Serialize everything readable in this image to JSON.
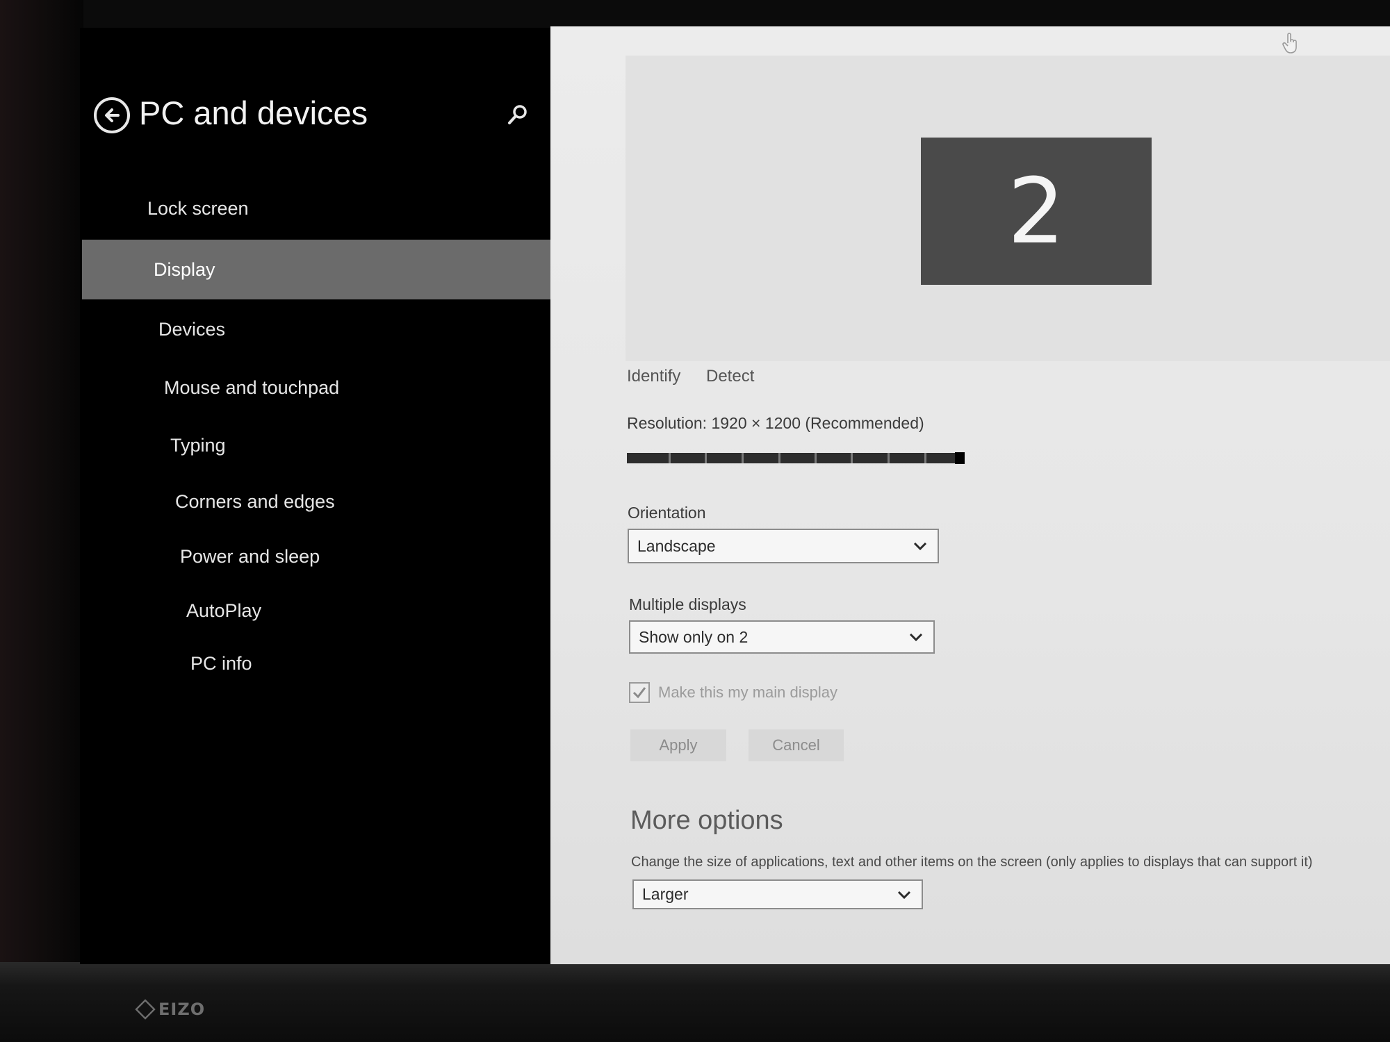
{
  "brand": {
    "logo_text": "EIZO"
  },
  "nav": {
    "title": "PC and devices",
    "items": [
      {
        "label": "Lock screen",
        "selected": false
      },
      {
        "label": "Display",
        "selected": true
      },
      {
        "label": "Devices",
        "selected": false
      },
      {
        "label": "Mouse and touchpad",
        "selected": false
      },
      {
        "label": "Typing",
        "selected": false
      },
      {
        "label": "Corners and edges",
        "selected": false
      },
      {
        "label": "Power and sleep",
        "selected": false
      },
      {
        "label": "AutoPlay",
        "selected": false
      },
      {
        "label": "PC info",
        "selected": false
      }
    ]
  },
  "display": {
    "monitor_number": "2",
    "identify_label": "Identify",
    "detect_label": "Detect",
    "resolution_label": "Resolution: 1920 × 1200 (Recommended)",
    "resolution_slider_fraction": 1.0,
    "orientation_label": "Orientation",
    "orientation_value": "Landscape",
    "multiple_displays_label": "Multiple displays",
    "multiple_displays_value": "Show only on 2",
    "main_display_label": "Make this my main display",
    "main_display_checked": true,
    "apply_label": "Apply",
    "cancel_label": "Cancel"
  },
  "more_options": {
    "heading": "More options",
    "description": "Change the size of applications, text and other items on the screen (only applies to displays that can support it)",
    "size_value": "Larger"
  },
  "colors": {
    "nav_background": "#000000",
    "nav_selected": "#6b6b6b",
    "content_background": "#e8e8e8",
    "monitor_tile": "#4a4a4a"
  },
  "icons": {
    "back": "back-arrow-circle-icon",
    "search": "search-icon",
    "dropdown": "chevron-down-icon",
    "check": "checkmark-icon",
    "cursor": "hand-cursor-icon"
  }
}
